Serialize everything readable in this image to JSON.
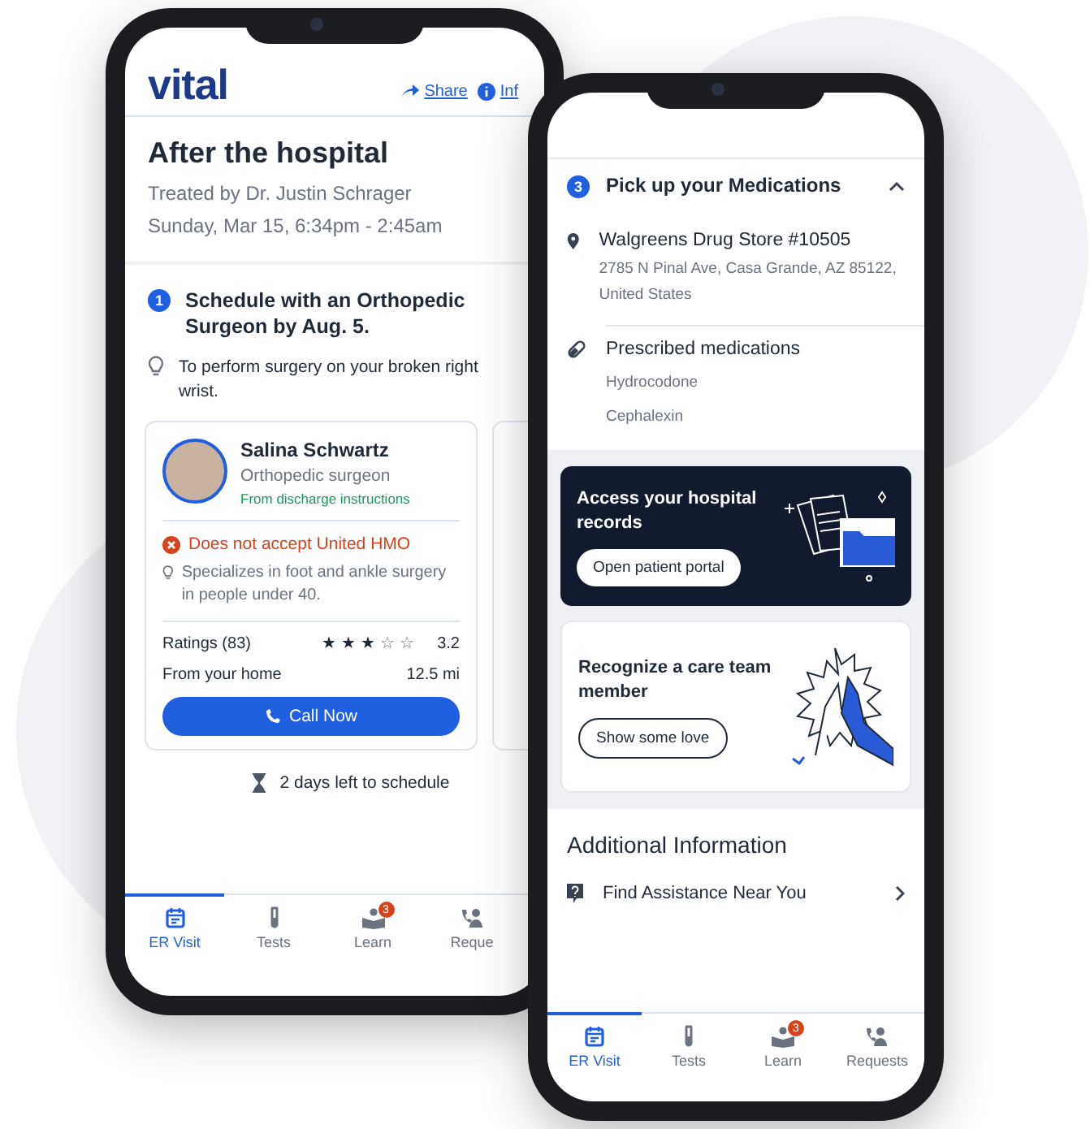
{
  "left_phone": {
    "logo": "vital",
    "header_links": [
      {
        "label": "Share",
        "kind": "share"
      },
      {
        "label": "Inf",
        "kind": "info"
      }
    ],
    "title": "After the hospital",
    "treated_by": "Treated by Dr. Justin Schrager",
    "visit_time": "Sunday, Mar 15, 6:34pm - 2:45am",
    "step": {
      "number": "1",
      "title": "Schedule with an Orthopedic Surgeon by Aug. 5.",
      "tip": "To perform surgery on your broken right wrist."
    },
    "doctor": {
      "name": "Salina Schwartz",
      "specialty": "Orthopedic surgeon",
      "source": "From discharge instructions",
      "insurance_warning": "Does not accept United HMO",
      "specialization": "Specializes in foot and ankle surgery in people under 40.",
      "ratings_label": "Ratings (83)",
      "stars": 3,
      "rating": "3.2",
      "distance_label": "From your home",
      "distance": "12.5 mi",
      "call_button": "Call Now"
    },
    "deadline": "2 days left to schedule",
    "tabs": [
      {
        "label": "ER Visit",
        "kind": "calendar",
        "selected": true
      },
      {
        "label": "Tests",
        "kind": "tube",
        "selected": false
      },
      {
        "label": "Learn",
        "kind": "learn",
        "selected": false,
        "badge": "3"
      },
      {
        "label": "Reque",
        "kind": "requests",
        "selected": false
      }
    ]
  },
  "right_phone": {
    "step": {
      "number": "3",
      "title": "Pick up your Medications",
      "expanded": true
    },
    "pharmacy": {
      "name": "Walgreens Drug Store #10505",
      "address": "2785 N Pinal Ave, Casa Grande, AZ 85122, United States"
    },
    "medications": {
      "title": "Prescribed medications",
      "items": [
        "Hydrocodone",
        "Cephalexin"
      ]
    },
    "records_card": {
      "title": "Access your hospital records",
      "button": "Open patient portal"
    },
    "recognize_card": {
      "title": "Recognize a care team member",
      "button": "Show some love"
    },
    "additional_title": "Additional Information",
    "additional_items": [
      {
        "label": "Find Assistance Near You"
      }
    ],
    "tabs": [
      {
        "label": "ER Visit",
        "kind": "calendar",
        "selected": true
      },
      {
        "label": "Tests",
        "kind": "tube",
        "selected": false
      },
      {
        "label": "Learn",
        "kind": "learn",
        "selected": false,
        "badge": "3"
      },
      {
        "label": "Requests",
        "kind": "requests",
        "selected": false
      }
    ]
  }
}
